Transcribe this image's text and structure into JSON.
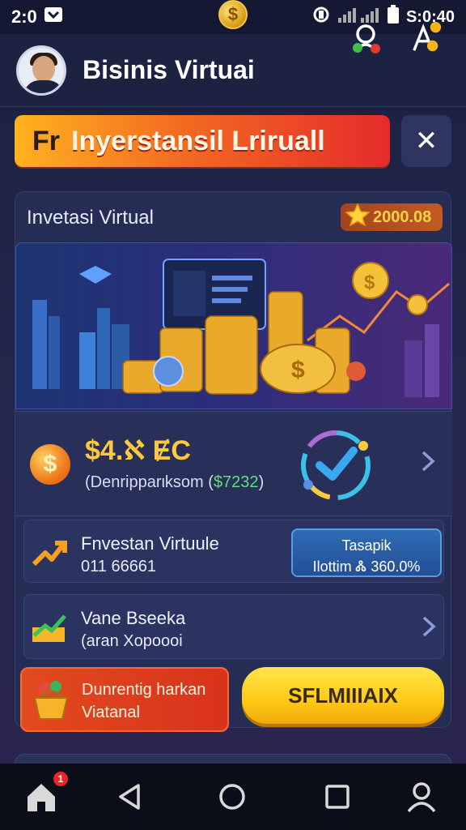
{
  "status_bar": {
    "time_left": "2:0",
    "time_right": "S:0:40",
    "coin_symbol": "$"
  },
  "header": {
    "title": "Bisinis Virtuai"
  },
  "banner": {
    "prefix": "Fr",
    "text": "Inyerstansil Lriruall",
    "close_symbol": "✕"
  },
  "card": {
    "title": "Invetasi Virtual",
    "points": "2000.08"
  },
  "balance": {
    "icon_symbol": "$",
    "amount": "$4.ℵ ɆC",
    "sub_label": "(Denripparιksom (",
    "sub_value": "$7232",
    "sub_close": ")"
  },
  "investment": {
    "title": "Fnvestan Virtuule",
    "sub": "011 66661",
    "return_label": "Tasapik",
    "return_value": "Ilottim Ꮬ 360.0%"
  },
  "value_row": {
    "title": "Vane Bseeka",
    "sub": "(aran Xopoooi"
  },
  "promo": {
    "line1": "Dunrentig harkan",
    "line2": "Viatanal"
  },
  "cta": {
    "label": "SFLMIIIAIX"
  },
  "nav": {
    "badge": "1"
  },
  "colors": {
    "accent_gold": "#ffc93c",
    "banner_red": "#e52b2b",
    "cta_yellow": "#ffd21a",
    "green_value": "#5de17a"
  }
}
